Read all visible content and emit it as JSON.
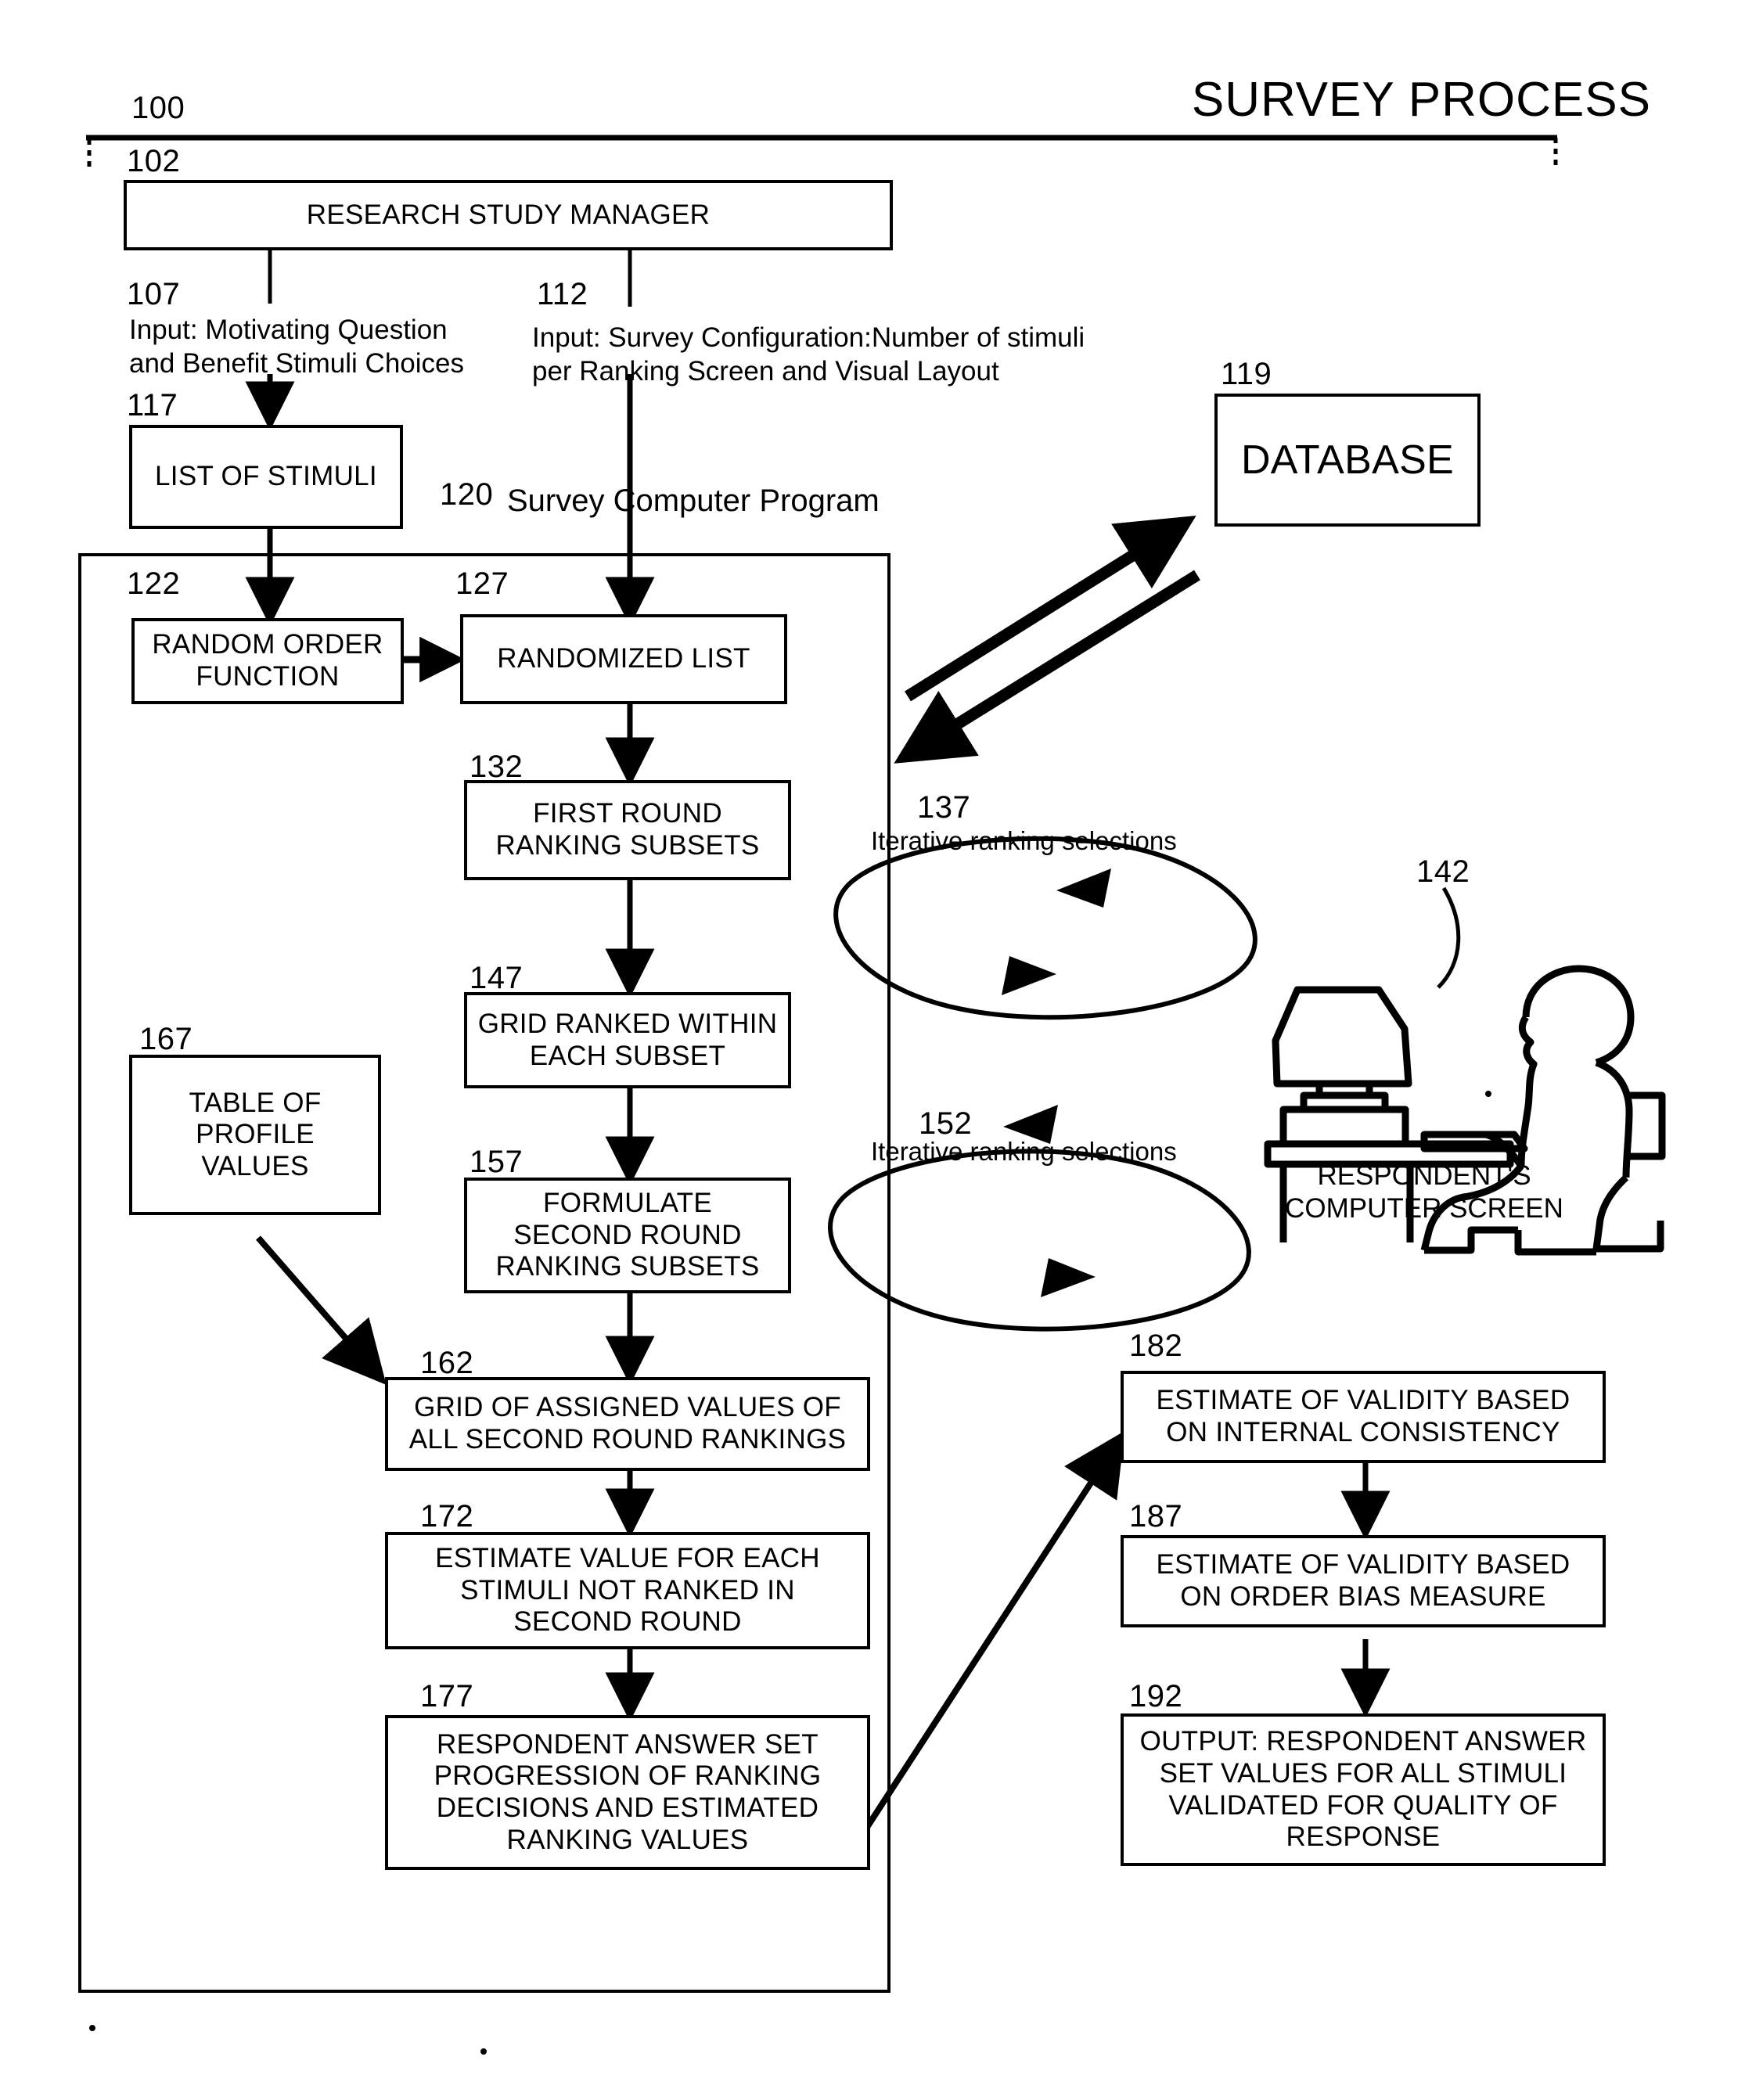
{
  "title": "SURVEY PROCESS",
  "refs": {
    "r100": "100",
    "r102": "102",
    "r107": "107",
    "r112": "112",
    "r117": "117",
    "r119": "119",
    "r120": "120",
    "r122": "122",
    "r127": "127",
    "r132": "132",
    "r137": "137",
    "r142": "142",
    "r147": "147",
    "r152": "152",
    "r157": "157",
    "r162": "162",
    "r167": "167",
    "r172": "172",
    "r177": "177",
    "r182": "182",
    "r187": "187",
    "r192": "192"
  },
  "nodes": {
    "research_study_manager": "RESEARCH STUDY MANAGER",
    "input_107": "Input: Motivating Question\nand Benefit Stimuli Choices",
    "input_112": "Input: Survey Configuration:Number of stimuli\nper Ranking Screen and Visual Layout",
    "list_of_stimuli": "LIST OF STIMULI",
    "database": "DATABASE",
    "program_label": "Survey Computer Program",
    "random_order_function": "RANDOM ORDER\nFUNCTION",
    "randomized_list": "RANDOMIZED LIST",
    "first_round_ranking_subsets": "FIRST ROUND\nRANKING SUBSETS",
    "grid_ranked_within_each_subset": "GRID RANKED WITHIN\nEACH SUBSET",
    "formulate_second_round_ranking_subsets": "FORMULATE\nSECOND ROUND\nRANKING SUBSETS",
    "table_of_profile_values": "TABLE OF\nPROFILE\nVALUES",
    "grid_of_assigned_values": "GRID OF ASSIGNED VALUES OF\nALL SECOND ROUND RANKINGS",
    "estimate_value_each_stimuli": "ESTIMATE VALUE FOR EACH\nSTIMULI NOT RANKED IN\nSECOND ROUND",
    "respondent_answer_set_progression": "RESPONDENT ANSWER SET\nPROGRESSION OF RANKING\nDECISIONS AND ESTIMATED\nRANKING VALUES",
    "estimate_validity_internal_consistency": "ESTIMATE OF VALIDITY BASED\nON INTERNAL CONSISTENCY",
    "estimate_validity_order_bias": "ESTIMATE OF VALIDITY BASED\nON ORDER BIAS MEASURE",
    "output_respondent_answer_set_values": "OUTPUT: RESPONDENT ANSWER\nSET VALUES FOR ALL STIMULI\nVALIDATED FOR QUALITY OF\nRESPONSE",
    "loop_137_label": "Iterative ranking selections",
    "loop_152_label": "Iterative ranking selections",
    "respondent_caption": "RESPONDENT'S\nCOMPUTER SCREEN"
  },
  "colors": {
    "ink": "#000000",
    "paper": "#ffffff"
  }
}
